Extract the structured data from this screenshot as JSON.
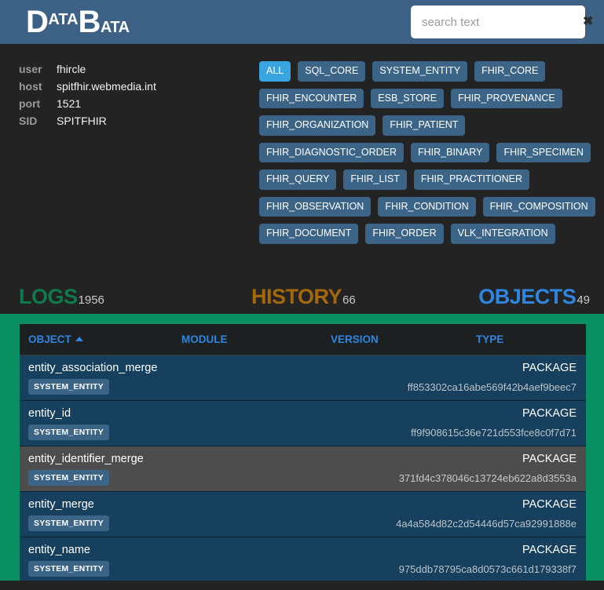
{
  "header": {
    "logo": {
      "d": "D",
      "d_sup": "ATA",
      "b": "B",
      "b_sup": "ATA"
    },
    "search": {
      "value": "",
      "placeholder": "search text",
      "clear_icon": "close-x-icon",
      "clear_glyph": "✖"
    }
  },
  "connection": {
    "rows": [
      {
        "key": "user",
        "value": "fhircle"
      },
      {
        "key": "host",
        "value": "spitfhir.webmedia.int"
      },
      {
        "key": "port",
        "value": "1521"
      },
      {
        "key": "SID",
        "value": "SPITFHIR"
      }
    ]
  },
  "tags": {
    "active": "ALL",
    "items": [
      {
        "label": "ALL",
        "active": true
      },
      {
        "label": "SQL_CORE",
        "active": false
      },
      {
        "label": "SYSTEM_ENTITY",
        "active": false
      },
      {
        "label": "FHIR_CORE",
        "active": false
      },
      {
        "label": "FHIR_ENCOUNTER",
        "active": false
      },
      {
        "label": "ESB_STORE",
        "active": false
      },
      {
        "label": "FHIR_PROVENANCE",
        "active": false
      },
      {
        "label": "FHIR_ORGANIZATION",
        "active": false
      },
      {
        "label": "FHIR_PATIENT",
        "active": false
      },
      {
        "label": "FHIR_DIAGNOSTIC_ORDER",
        "active": false
      },
      {
        "label": "FHIR_BINARY",
        "active": false
      },
      {
        "label": "FHIR_SPECIMEN",
        "active": false
      },
      {
        "label": "FHIR_QUERY",
        "active": false
      },
      {
        "label": "FHIR_LIST",
        "active": false
      },
      {
        "label": "FHIR_PRACTITIONER",
        "active": false
      },
      {
        "label": "FHIR_OBSERVATION",
        "active": false
      },
      {
        "label": "FHIR_CONDITION",
        "active": false
      },
      {
        "label": "FHIR_COMPOSITION",
        "active": false
      },
      {
        "label": "FHIR_DOCUMENT",
        "active": false
      },
      {
        "label": "FHIR_ORDER",
        "active": false
      },
      {
        "label": "VLK_INTEGRATION",
        "active": false
      }
    ]
  },
  "stats": {
    "logs": {
      "label": "LOGS",
      "count": "1956",
      "color": "#0e7a4e"
    },
    "history": {
      "label": "HISTORY",
      "count": "66",
      "color": "#a3680a"
    },
    "objects": {
      "label": "OBJECTS",
      "count": "49",
      "color": "#2f85e0"
    }
  },
  "table": {
    "columns": {
      "object": "OBJECT",
      "module": "MODULE",
      "version": "VERSION",
      "type": "TYPE"
    },
    "sort": {
      "column": "OBJECT",
      "direction": "asc",
      "icon": "caret-up-icon"
    },
    "rows": [
      {
        "name": "entity_association_merge",
        "badge": "SYSTEM_ENTITY",
        "type": "PACKAGE",
        "hash": "ff853302ca16abe569f42b4aef9beec7",
        "hover": false
      },
      {
        "name": "entity_id",
        "badge": "SYSTEM_ENTITY",
        "type": "PACKAGE",
        "hash": "ff9f908615c36e721d553fce8c0f7d71",
        "hover": false
      },
      {
        "name": "entity_identifier_merge",
        "badge": "SYSTEM_ENTITY",
        "type": "PACKAGE",
        "hash": "371fd4c378046c13724eb622a8d3553a",
        "hover": true
      },
      {
        "name": "entity_merge",
        "badge": "SYSTEM_ENTITY",
        "type": "PACKAGE",
        "hash": "4a4a584d82c2d54446d57ca92991888e",
        "hover": false
      },
      {
        "name": "entity_name",
        "badge": "SYSTEM_ENTITY",
        "type": "PACKAGE",
        "hash": "975ddb78795ca8d0573c661d179338f7",
        "hover": false
      }
    ]
  },
  "theme": {
    "header_bg": "#3d6184",
    "page_bg": "#232323",
    "panel_green": "#0a8f63",
    "row_blue": "#17405e",
    "row_hover": "#4d4d4d",
    "tag_blue": "#3b6487",
    "tag_active": "#39a5e0"
  }
}
